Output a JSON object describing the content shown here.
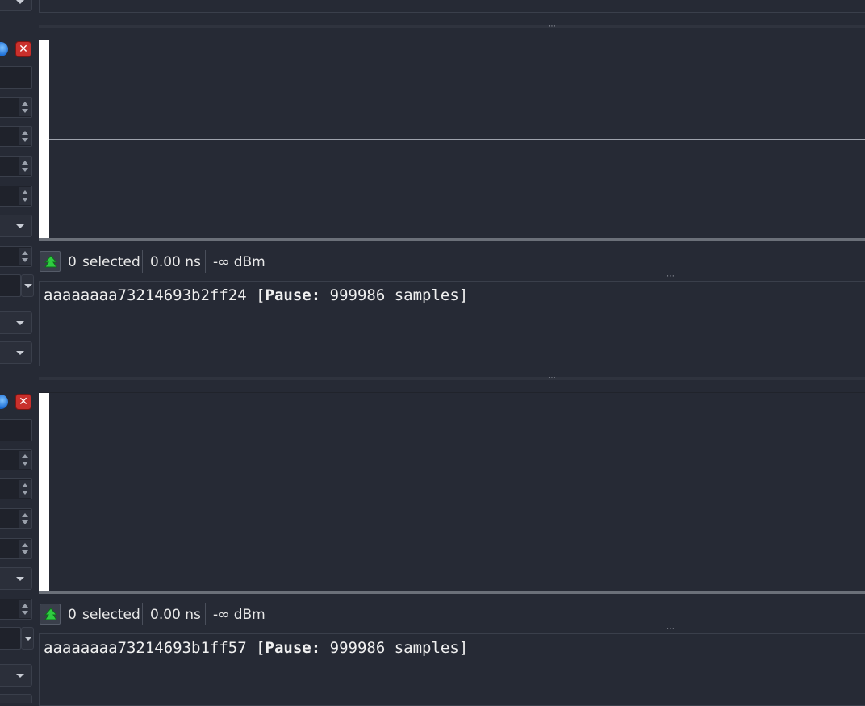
{
  "panels": [
    {
      "info": {
        "selected_count": "0",
        "selected_label": "selected",
        "duration": "0.00 ns",
        "power": "-∞ dBm"
      },
      "text": {
        "prefix": "aaaaaaaa73214693b2ff24 [",
        "keyword": "Pause:",
        "suffix": " 999986 samples]"
      }
    },
    {
      "info": {
        "selected_count": "0",
        "selected_label": "selected",
        "duration": "0.00 ns",
        "power": "-∞ dBm"
      },
      "text": {
        "prefix": "aaaaaaaa73214693b1ff57 [",
        "keyword": "Pause:",
        "suffix": " 999986 samples]"
      }
    }
  ],
  "icons": {
    "close": "close-icon",
    "blue": "blue-circle-icon",
    "tree": "green-tree-icon"
  },
  "colors": {
    "background": "#262a35",
    "cursor": "#ffffff",
    "close": "#c9302c",
    "tree": "#2ecc40"
  }
}
